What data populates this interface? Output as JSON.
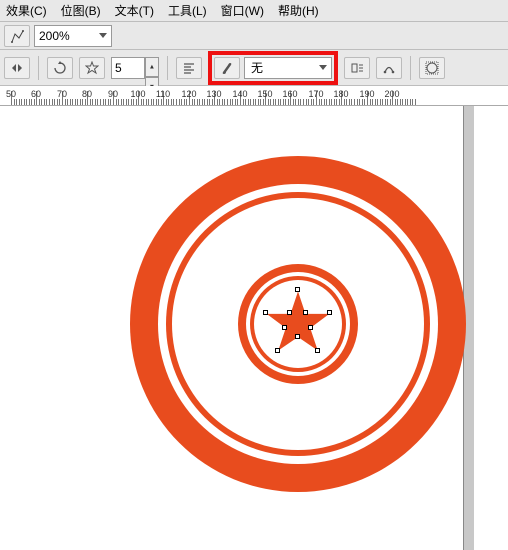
{
  "menu": {
    "effects": "效果(C)",
    "bitmap": "位图(B)",
    "text": "文本(T)",
    "tools": "工具(L)",
    "window": "窗口(W)",
    "help": "帮助(H)"
  },
  "toolbar1": {
    "zoom": "200%"
  },
  "toolbar2": {
    "spin_points": "5",
    "brush_sel": "无"
  },
  "ruler": {
    "ticks": [
      "50",
      "60",
      "70",
      "80",
      "90",
      "100",
      "110",
      "120",
      "130",
      "140",
      "150",
      "160",
      "170",
      "180",
      "190",
      "200"
    ]
  },
  "accent": "#e84c1e",
  "highlight": "#e11"
}
